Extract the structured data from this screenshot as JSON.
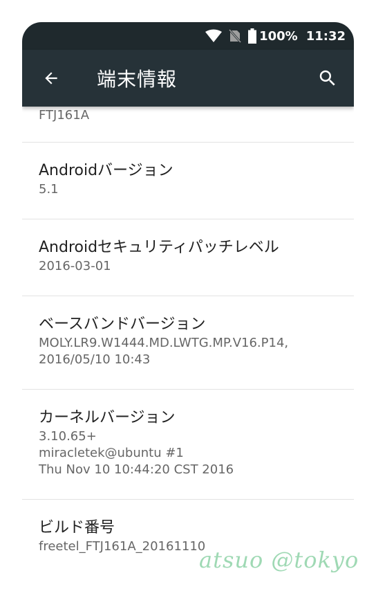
{
  "status_bar": {
    "battery_percent": "100%",
    "time": "11:32",
    "icons": [
      "wifi-icon",
      "no-sim-icon",
      "battery-icon"
    ]
  },
  "app_bar": {
    "title": "端末情報",
    "back_icon": "arrow-back-icon",
    "search_icon": "search-icon"
  },
  "items": [
    {
      "label": "",
      "value": "FTJ161A"
    },
    {
      "label": "Androidバージョン",
      "value": "5.1"
    },
    {
      "label": "Androidセキュリティパッチレベル",
      "value": "2016-03-01"
    },
    {
      "label": "ベースバンドバージョン",
      "value": "MOLY.LR9.W1444.MD.LWTG.MP.V16.P14,\n2016/05/10 10:43"
    },
    {
      "label": "カーネルバージョン",
      "value": "3.10.65+\nmiracletek@ubuntu #1\nThu Nov 10 10:44:20 CST 2016"
    },
    {
      "label": "ビルド番号",
      "value": "freetel_FTJ161A_20161110"
    }
  ],
  "watermark": "atsuo @tokyo",
  "colors": {
    "status_bar": "#1f292d",
    "app_bar": "#263238",
    "primary_text": "#212121",
    "secondary_text": "#666666",
    "divider": "#e3e3e3",
    "watermark": "#8fd3a8"
  }
}
